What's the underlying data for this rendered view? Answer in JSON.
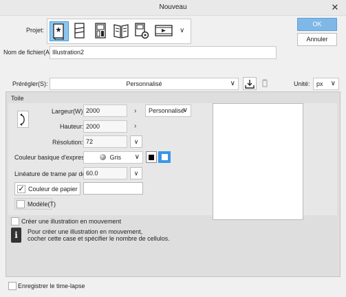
{
  "window": {
    "title": "Nouveau",
    "close_glyph": "✕"
  },
  "actions": {
    "ok": "OK",
    "cancel": "Annuler"
  },
  "project": {
    "label_text": "Projet",
    "label_tail": ":",
    "selected_index": 0,
    "icons": [
      "illustration-icon",
      "webtoon-icon",
      "comic-icon",
      "book-icon",
      "settings-page-icon",
      "animation-icon"
    ]
  },
  "filename": {
    "label": "Nom de fichier(A):",
    "value": "Illustration2"
  },
  "preset": {
    "label": "Prérégler(S):",
    "value": "Personnalisé",
    "unit_label": "Unité:",
    "unit_value": "px"
  },
  "canvas": {
    "section_label": "Toile",
    "width_label": "Largeur(W):",
    "width_value": "2000",
    "height_label": "Hauteur:",
    "height_value": "2000",
    "size_preset": "Personnalisé",
    "resolution_label": "Résolution:",
    "resolution_value": "72",
    "color_label": "Couleur basique d'expression:",
    "color_value": "Gris",
    "linature_label": "Linéature de trame par défaut:",
    "linature_value": "60.0",
    "paper_color_label": "Couleur de papier",
    "paper_color_checked": true,
    "template_label": "Modèle(T)",
    "template_checked": false
  },
  "animation": {
    "checkbox_label": "Créer une illustration en mouvement",
    "checked": false,
    "info_icon": "i",
    "info_line1": "Pour créer une illustration en mouvement,",
    "info_line2": "cocher cette case et spécifier le nombre de cellulos."
  },
  "timelapse": {
    "label": "Enregistrer le time-lapse",
    "checked": false
  }
}
